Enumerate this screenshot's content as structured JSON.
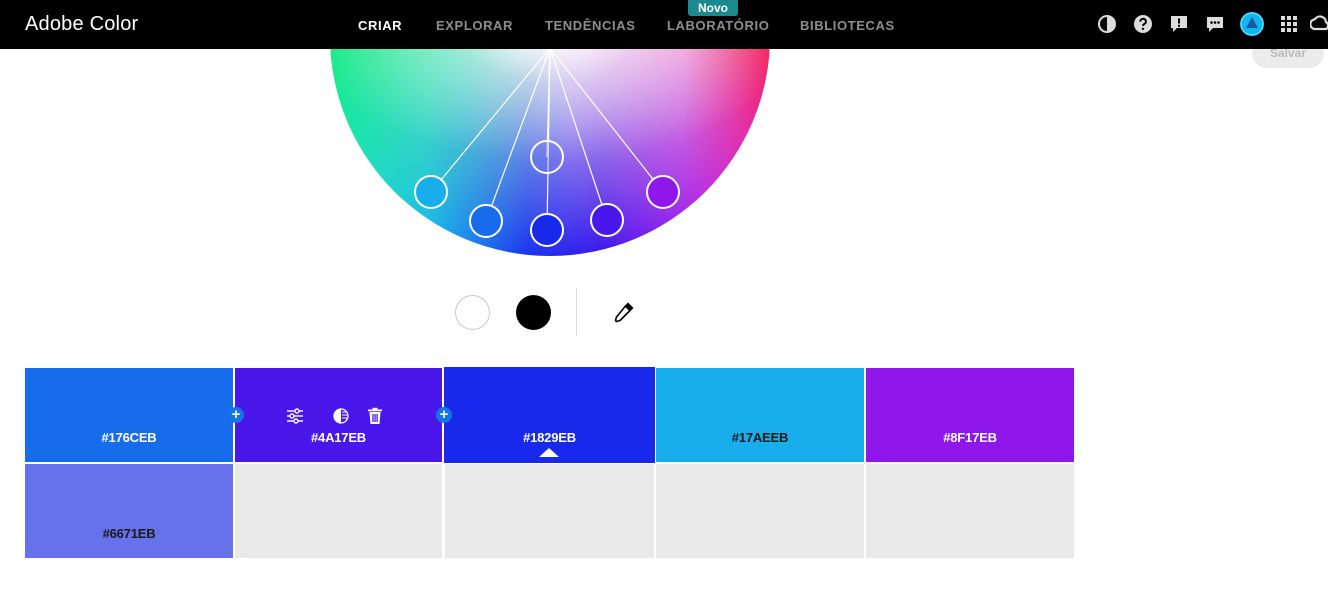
{
  "header": {
    "brand": "Adobe Color",
    "nav": [
      {
        "label": "CRIAR",
        "active": true
      },
      {
        "label": "EXPLORAR",
        "active": false
      },
      {
        "label": "TENDÊNCIAS",
        "active": false
      },
      {
        "label": "LABORATÓRIO",
        "active": false
      },
      {
        "label": "BIBLIOTECAS",
        "active": false
      }
    ],
    "new_badge": "Novo",
    "icons": [
      "contrast-icon",
      "help-icon",
      "feedback-icon",
      "chat-icon",
      "profile-avatar",
      "apps-grid-icon",
      "creative-cloud-icon"
    ]
  },
  "save_button": "Salvar",
  "tools": {
    "white_icon": "white-color-icon",
    "black_icon": "black-color-icon",
    "eyedropper_icon": "eyedropper-icon"
  },
  "palette": {
    "colors": [
      "#176CEB",
      "#4A17EB",
      "#1829EB",
      "#17AEEB",
      "#8F17EB"
    ],
    "shades": [
      "#6671EB"
    ],
    "base_index": 2,
    "selected_index": 1,
    "swatch_tool_icons": [
      "sliders-icon",
      "contrast-half-icon",
      "trash-icon"
    ]
  },
  "colors": {
    "accent": "#1473e6",
    "header_bg": "#000000",
    "badge": "#1b8a8f",
    "empty_cell": "#e9e9e9"
  }
}
